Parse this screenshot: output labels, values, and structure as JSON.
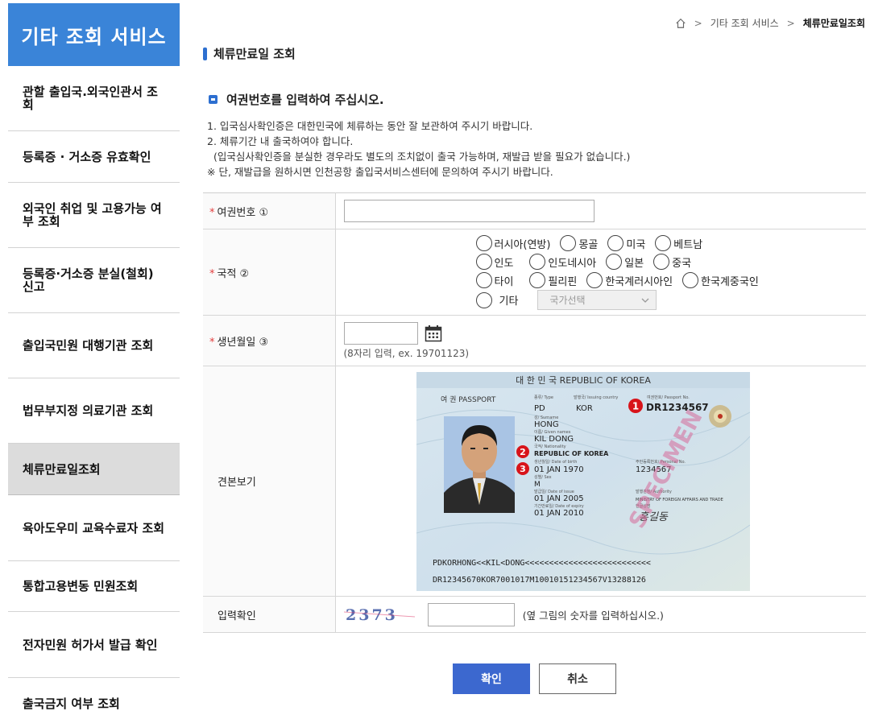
{
  "sidebar": {
    "title": "기타 조회 서비스",
    "items": [
      {
        "label": "관할 출입국.외국인관서 조회"
      },
      {
        "label": "등록증 · 거소증 유효확인"
      },
      {
        "label": "외국인 취업 및 고용가능 여부 조회"
      },
      {
        "label": "등록증·거소증 분실(철회) 신고"
      },
      {
        "label": "출입국민원 대행기관 조회"
      },
      {
        "label": "법무부지정 의료기관 조회"
      },
      {
        "label": "체류만료일조회"
      },
      {
        "label": "육아도우미 교육수료자 조회"
      },
      {
        "label": "통합고용변동 민원조회"
      },
      {
        "label": "전자민원 허가서 발급 확인"
      },
      {
        "label": "출국금지 여부 조회"
      }
    ],
    "active_index": 6
  },
  "breadcrumb": {
    "home_icon": "home-icon",
    "sep": ">",
    "level1": "기타 조회 서비스",
    "current": "체류만료일조회"
  },
  "page": {
    "title": "체류만료일 조회",
    "section_heading": "여권번호를 입력하여 주십시오.",
    "notes": [
      "1. 입국심사확인증은 대한민국에 체류하는 동안 잘 보관하여 주시기 바랍니다.",
      "2. 체류기간 내 출국하여야 합니다.",
      "  (입국심사확인증을 분실한 경우라도 별도의 조치없이 출국 가능하며, 재발급 받을 필요가 없습니다.)",
      "※ 단, 재발급을 원하시면 인천공항 출입국서비스센터에 문의하여 주시기 바랍니다."
    ]
  },
  "form": {
    "required_mark": "*",
    "passport_label": "여권번호 ①",
    "passport_value": "",
    "nationality_label": "국적 ②",
    "nationality_rows": [
      [
        "러시아(연방)",
        "몽골",
        "미국",
        "베트남"
      ],
      [
        "인도",
        "인도네시아",
        "일본",
        "중국"
      ],
      [
        "타이",
        "필리핀",
        "한국계러시아인",
        "한국계중국인"
      ]
    ],
    "other_label": "기타",
    "country_select": "국가선택",
    "birth_label": "생년월일 ③",
    "birth_value": "",
    "birth_hint": "(8자리 입력, ex. 19701123)",
    "sample_label": "견본보기",
    "captcha_label": "입력확인",
    "captcha_text": "2373",
    "captcha_value": "",
    "captcha_hint": "(옆 그림의 숫자를 입력하십시오.)"
  },
  "passport_sample": {
    "header": "대 한 민 국   REPUBLIC OF KOREA",
    "doc_label": "여 권  PASSPORT",
    "type_label": "종류/ Type",
    "type": "PD",
    "issuing_label": "발행국/ Issuing country",
    "country_code": "KOR",
    "number_label": "여권번호/ Passport No.",
    "passport_no": "DR1234567",
    "surname_label": "성/ Surname",
    "surname": "HONG",
    "given_label": "이름/ Given names",
    "given_names": "KIL DONG",
    "nationality_label": "국적/ Nationality",
    "nationality": "REPUBLIC OF KOREA",
    "dob_label": "생년월일/ Date of birth",
    "dob": "01 JAN 1970",
    "personal_label": "주민등록번호/ Personal No.",
    "personal_no": "1234567",
    "sex_label": "성별/ Sex",
    "sex": "M",
    "issue_label": "발급일/ Date of issue",
    "issue_date": "01 JAN 2005",
    "authority_label": "발행관청/ Authority",
    "authority": "MINISTRY OF FOREIGN AFFAIRS AND TRADE",
    "expiry_label": "기간만료일/ Date of expiry",
    "expiry_date": "01 JAN 2010",
    "signature_label": "한글성명",
    "signature_name": "홍길동",
    "specimen": "SPECIMEN",
    "mrz1": "PDKORHONG<<KIL<DONG<<<<<<<<<<<<<<<<<<<<<<<<<<",
    "mrz2": "DR12345670KOR7001017M10010151234567V13288126",
    "marker1": "1",
    "marker2": "2",
    "marker3": "3"
  },
  "buttons": {
    "confirm": "확인",
    "cancel": "취소"
  },
  "colors": {
    "sidebar_header": "#3a84d8",
    "primary_button": "#3c68cf",
    "required": "#e23c3c",
    "marker": "#d8141a"
  }
}
